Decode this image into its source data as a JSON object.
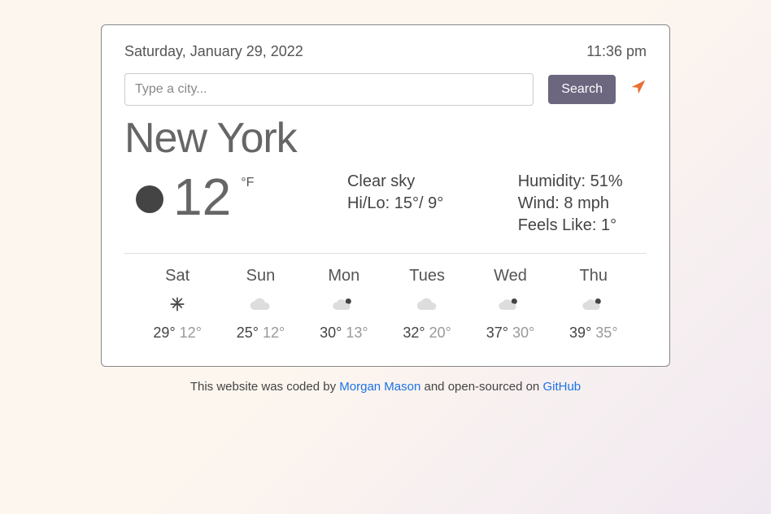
{
  "header": {
    "date": "Saturday, January 29, 2022",
    "time": "11:36 pm"
  },
  "search": {
    "placeholder": "Type a city...",
    "button": "Search"
  },
  "current": {
    "city": "New York",
    "temp": "12",
    "unit": "°F",
    "condition": "Clear sky",
    "hi": "15",
    "lo": "9",
    "humidity_label": "Humidity:",
    "humidity": "51%",
    "wind_label": "Wind:",
    "wind": "8 mph",
    "feels_label": "Feels Like:",
    "feels": "1°",
    "hilo_prefix": "Hi/Lo: "
  },
  "forecast": [
    {
      "day": "Sat",
      "icon": "snowflake",
      "hi": "29",
      "lo": "12"
    },
    {
      "day": "Sun",
      "icon": "cloud",
      "hi": "25",
      "lo": "12"
    },
    {
      "day": "Mon",
      "icon": "cloud-sun",
      "hi": "30",
      "lo": "13"
    },
    {
      "day": "Tues",
      "icon": "cloud",
      "hi": "32",
      "lo": "20"
    },
    {
      "day": "Wed",
      "icon": "cloud-sun",
      "hi": "37",
      "lo": "30"
    },
    {
      "day": "Thu",
      "icon": "cloud-sun",
      "hi": "39",
      "lo": "35"
    }
  ],
  "footer": {
    "text_before": "This website was coded by ",
    "author": "Morgan Mason",
    "text_middle": " and open-sourced on ",
    "github": "GitHub"
  }
}
